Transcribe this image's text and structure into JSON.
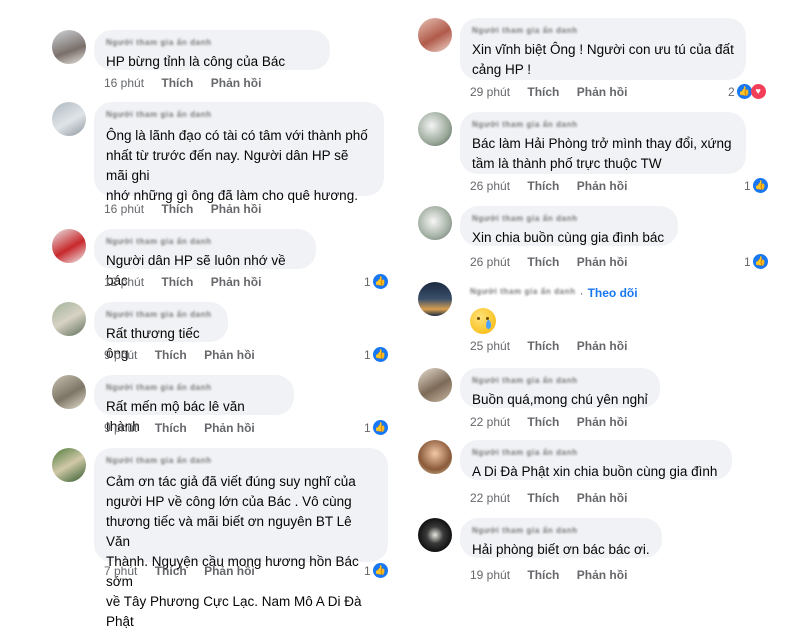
{
  "actions": {
    "like": "Thích",
    "reply": "Phản hồi",
    "follow": "Theo dõi"
  },
  "blurred_name": "Người tham gia ẩn danh",
  "colors": {
    "bubble": "#f0f2f5",
    "meta": "#65676b",
    "like_blue": "#1877f2",
    "heart_red": "#f33e58"
  },
  "left_comments": [
    {
      "text": "HP bừng tỉnh là công của Bác",
      "time": "16 phút",
      "reactions": ""
    },
    {
      "text": "Ông là lãnh đạo có tài có tâm với  thành phố\nnhất từ trước đến nay. Người dân HP sẽ mãi ghi\nnhớ những gì ông đã làm cho quê hương.",
      "time": "16 phút",
      "reactions": ""
    },
    {
      "text": "Người dân HP sẽ luôn nhớ về bác",
      "time": "12 phút",
      "reactions": "1"
    },
    {
      "text": "Rất thương tiếc ông",
      "time": "9 phút",
      "reactions": "1"
    },
    {
      "text": "Rất  mến  mộ bác  lê  văn thành",
      "time": "9 phút",
      "reactions": "1"
    },
    {
      "text": "Cảm ơn tác giả đã viết đúng suy nghĩ của\nngười HP về công lớn của Bác . Vô cùng\nthương tiếc và  mãi biết ơn nguyên  BT Lê Văn\nThành. Nguyện cầu mong hương hồn  Bác sớm\nvề Tây Phương Cực Lạc. Nam Mô A Di Đà Phật",
      "time": "7 phút",
      "reactions": "1"
    }
  ],
  "right_comments": [
    {
      "text": "Xin vĩnh biệt Ông ! Người con ưu tú của đất\ncảng HP !",
      "time": "29 phút",
      "reactions": "2"
    },
    {
      "text": "Bác làm Hải Phòng trở mình thay đổi, xứng\ntầm là thành phố trực thuộc TW",
      "time": "26 phút",
      "reactions": "1"
    },
    {
      "text": "Xin chia buồn cùng gia đình bác",
      "time": "26 phút",
      "reactions": "1"
    },
    {
      "text": "",
      "emoji": "crying-face-emoji",
      "time": "25 phút",
      "reactions": ""
    },
    {
      "text": "Buồn quá,mong chú yên nghỉ",
      "time": "22 phút",
      "reactions": ""
    },
    {
      "text": "A Di Đà Phật xin chia buồn cùng gia đình",
      "time": "22 phút",
      "reactions": ""
    },
    {
      "text": "Hải phòng biết ơn bác bác ơi.",
      "time": "19 phút",
      "reactions": ""
    }
  ]
}
